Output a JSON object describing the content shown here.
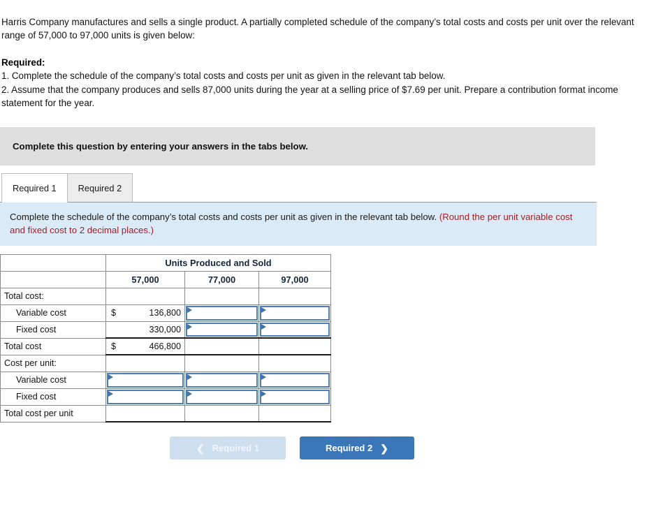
{
  "problem": {
    "paragraph": "Harris Company manufactures and sells a single product. A partially completed schedule of the company’s total costs and costs per unit over the relevant range of 57,000 to 97,000 units is given below:",
    "required_heading": "Required:",
    "req1": "1. Complete the schedule of the company’s total costs and costs per unit as given in the relevant tab below.",
    "req2": "2. Assume that the company produces and sells 87,000 units during the year at a selling price of $7.69 per unit. Prepare a contribution format income statement for the year."
  },
  "gray_banner": {
    "text": "Complete this question by entering your answers in the tabs below."
  },
  "tabs": [
    {
      "label": "Required 1",
      "active": true
    },
    {
      "label": "Required 2",
      "active": false
    }
  ],
  "blue_banner": {
    "main": "Complete the schedule of the company’s total costs and costs per unit as given in the relevant tab below. ",
    "note": "(Round the per unit variable cost and fixed cost to 2 decimal places.)"
  },
  "table": {
    "group_header": "Units Produced and Sold",
    "column_headers": [
      "57,000",
      "77,000",
      "97,000"
    ],
    "rows": [
      {
        "label": "Total cost:",
        "indent": false,
        "cells": [
          {
            "type": "blank"
          },
          {
            "type": "blank"
          },
          {
            "type": "blank"
          }
        ]
      },
      {
        "label": "Variable cost",
        "indent": true,
        "cells": [
          {
            "type": "value",
            "currency": "$",
            "value": "136,800"
          },
          {
            "type": "input"
          },
          {
            "type": "input"
          }
        ]
      },
      {
        "label": "Fixed cost",
        "indent": true,
        "cells": [
          {
            "type": "value",
            "currency": "",
            "value": "330,000"
          },
          {
            "type": "input"
          },
          {
            "type": "input"
          }
        ]
      },
      {
        "label": "Total cost",
        "indent": false,
        "rule": "top",
        "cells": [
          {
            "type": "value",
            "currency": "$",
            "value": "466,800"
          },
          {
            "type": "blank"
          },
          {
            "type": "blank"
          }
        ]
      },
      {
        "label": "Cost per unit:",
        "indent": false,
        "rule": "top",
        "cells": [
          {
            "type": "blank"
          },
          {
            "type": "blank"
          },
          {
            "type": "blank"
          }
        ]
      },
      {
        "label": "Variable cost",
        "indent": true,
        "cells": [
          {
            "type": "input"
          },
          {
            "type": "input"
          },
          {
            "type": "input"
          }
        ]
      },
      {
        "label": "Fixed cost",
        "indent": true,
        "cells": [
          {
            "type": "input"
          },
          {
            "type": "input"
          },
          {
            "type": "input"
          }
        ]
      },
      {
        "label": "Total cost per unit",
        "indent": false,
        "rule": "bottom",
        "cells": [
          {
            "type": "blank"
          },
          {
            "type": "blank"
          },
          {
            "type": "blank"
          }
        ]
      }
    ]
  },
  "nav": {
    "prev_label": "Required 1",
    "prev_icon": "chevron-left-icon",
    "next_label": "Required 2",
    "next_icon": "chevron-right-icon"
  },
  "colors": {
    "header_blue": "#7fb0e3",
    "banner_gray": "#dedede",
    "banner_blue": "#daeaf7",
    "note_red": "#a51d23",
    "button_blue": "#3a76b8",
    "button_disabled": "#cddeee",
    "input_border": "#4a7fb5"
  }
}
